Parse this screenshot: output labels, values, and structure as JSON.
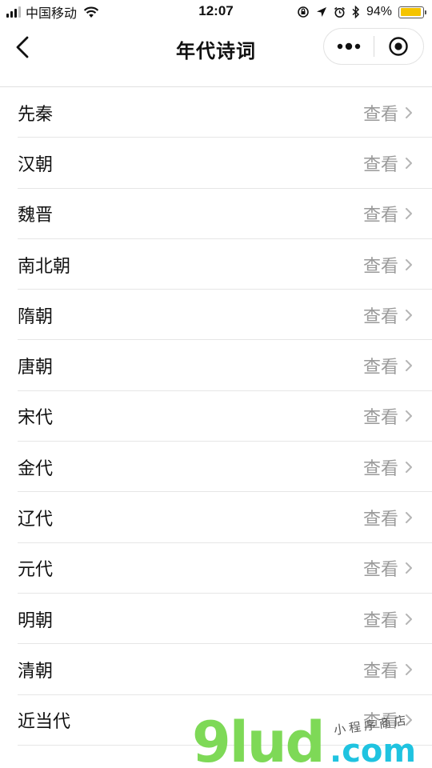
{
  "status_bar": {
    "carrier": "中国移动",
    "time": "12:07",
    "battery_percent": "94%",
    "battery_level": 0.94,
    "battery_color": "#f5c400"
  },
  "nav": {
    "title": "年代诗词",
    "back_icon": "chevron-left-icon",
    "more_icon": "more-dots-icon",
    "close_icon": "target-close-icon"
  },
  "list": {
    "action_label": "查看",
    "items": [
      {
        "label": "先秦"
      },
      {
        "label": "汉朝"
      },
      {
        "label": "魏晋"
      },
      {
        "label": "南北朝"
      },
      {
        "label": "隋朝"
      },
      {
        "label": "唐朝"
      },
      {
        "label": "宋代"
      },
      {
        "label": "金代"
      },
      {
        "label": "辽代"
      },
      {
        "label": "元代"
      },
      {
        "label": "明朝"
      },
      {
        "label": "清朝"
      },
      {
        "label": "近当代"
      }
    ]
  },
  "watermark": {
    "brand": "9lud",
    "suffix": ".com",
    "tagline": "小程序商店",
    "green": "#7ed957",
    "cyan": "#1fc3e0"
  }
}
